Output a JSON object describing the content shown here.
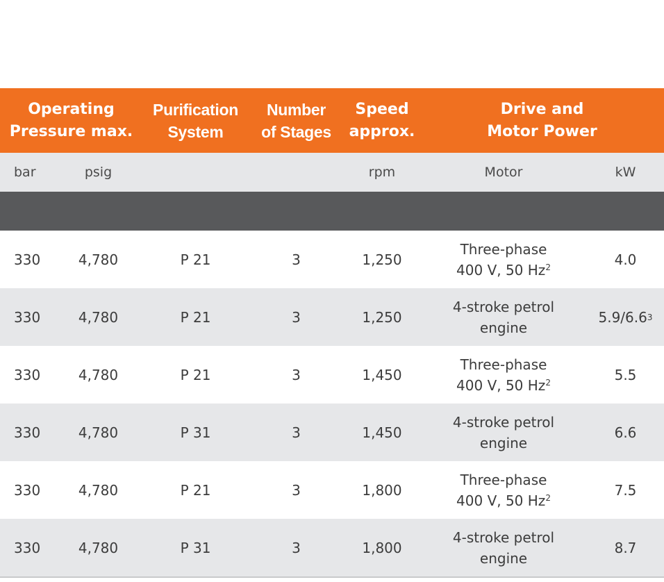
{
  "header": {
    "pressure_line1": "Operating",
    "pressure_line2": "Pressure max.",
    "purification_line1": "Purification",
    "purification_line2": "System",
    "stages_line1": "Number",
    "stages_line2": "of Stages",
    "speed_line1": "Speed",
    "speed_line2": "approx.",
    "drive_line1": "Drive and",
    "drive_line2": "Motor Power"
  },
  "units": {
    "bar": "bar",
    "psig": "psig",
    "rpm": "rpm",
    "motor": "Motor",
    "kw": "kW"
  },
  "colors": {
    "header_bg": "#f07020",
    "shade_bg": "#e6e7e9",
    "band_bg": "#58595b"
  },
  "rows": [
    {
      "bar": "330",
      "psig": "4,780",
      "purification": "P 21",
      "stages": "3",
      "speed": "1,250",
      "motor_line1": "Three-phase",
      "motor_line2": "400 V, 50 Hz",
      "motor_sup": "2",
      "kw": "4.0",
      "kw_sup": ""
    },
    {
      "bar": "330",
      "psig": "4,780",
      "purification": "P 21",
      "stages": "3",
      "speed": "1,250",
      "motor_line1": "4-stroke petrol",
      "motor_line2": "engine",
      "motor_sup": "",
      "kw": "5.9/6.6",
      "kw_sup": "3"
    },
    {
      "bar": "330",
      "psig": "4,780",
      "purification": "P 21",
      "stages": "3",
      "speed": "1,450",
      "motor_line1": "Three-phase",
      "motor_line2": "400 V, 50 Hz",
      "motor_sup": "2",
      "kw": "5.5",
      "kw_sup": ""
    },
    {
      "bar": "330",
      "psig": "4,780",
      "purification": "P 31",
      "stages": "3",
      "speed": "1,450",
      "motor_line1": "4-stroke petrol",
      "motor_line2": "engine",
      "motor_sup": "",
      "kw": "6.6",
      "kw_sup": ""
    },
    {
      "bar": "330",
      "psig": "4,780",
      "purification": "P 21",
      "stages": "3",
      "speed": "1,800",
      "motor_line1": "Three-phase",
      "motor_line2": "400 V, 50 Hz",
      "motor_sup": "2",
      "kw": "7.5",
      "kw_sup": ""
    },
    {
      "bar": "330",
      "psig": "4,780",
      "purification": "P 31",
      "stages": "3",
      "speed": "1,800",
      "motor_line1": "4-stroke petrol",
      "motor_line2": "engine",
      "motor_sup": "",
      "kw": "8.7",
      "kw_sup": ""
    }
  ]
}
